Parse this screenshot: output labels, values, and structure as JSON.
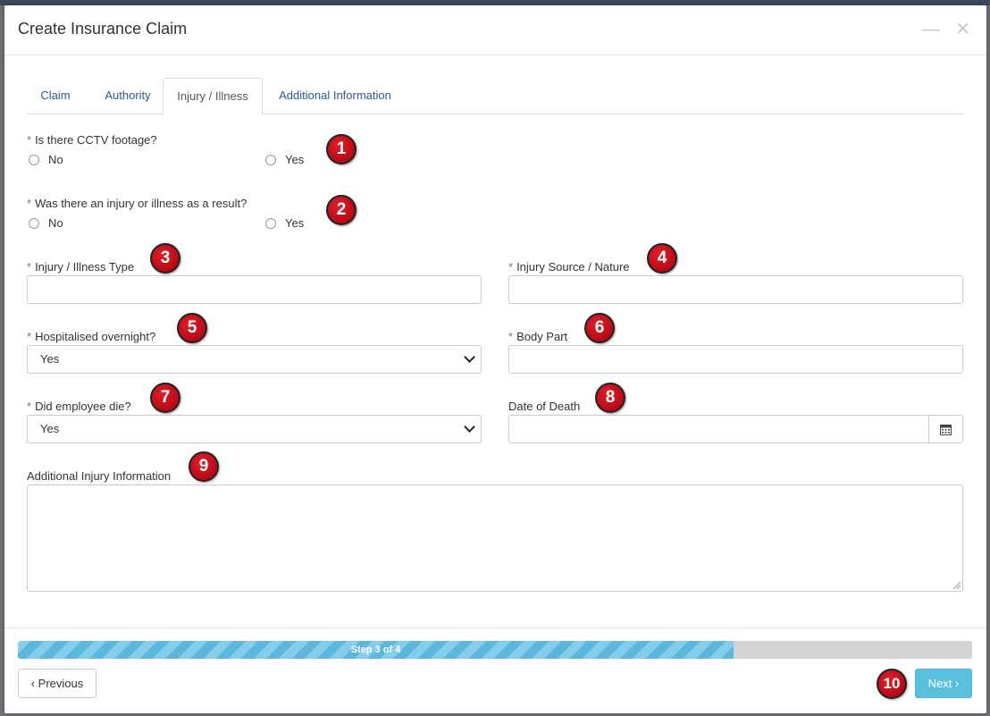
{
  "modal": {
    "title": "Create Insurance Claim",
    "minimize_icon": "minimize-icon",
    "close_icon": "close-icon"
  },
  "tabs": [
    "Claim",
    "Authority",
    "Injury / Illness",
    "Additional Information"
  ],
  "active_tab": "Injury / Illness",
  "required_marker": "*",
  "form": {
    "cctv": {
      "label": "Is there CCTV footage?",
      "options": [
        "No",
        "Yes"
      ],
      "selected": null
    },
    "injury_result": {
      "label": "Was there an injury or illness as a result?",
      "options": [
        "No",
        "Yes"
      ],
      "selected": null
    },
    "injury_type": {
      "label": "Injury / Illness Type",
      "value": ""
    },
    "injury_source": {
      "label": "Injury Source / Nature",
      "value": ""
    },
    "hospitalised": {
      "label": "Hospitalised overnight?",
      "value": "Yes"
    },
    "body_part": {
      "label": "Body Part",
      "value": ""
    },
    "employee_die": {
      "label": "Did employee die?",
      "value": "Yes"
    },
    "date_of_death": {
      "label": "Date of Death",
      "value": "",
      "icon": "calendar-icon"
    },
    "additional_info": {
      "label": "Additional Injury Information",
      "value": ""
    }
  },
  "annotations": [
    "1",
    "2",
    "3",
    "4",
    "5",
    "6",
    "7",
    "8",
    "9",
    "10"
  ],
  "progress": {
    "label": "Step 3 of 4",
    "percent": 75,
    "fill_color": "#5bb7dd"
  },
  "buttons": {
    "previous": "‹ Previous",
    "next": "Next ›"
  }
}
